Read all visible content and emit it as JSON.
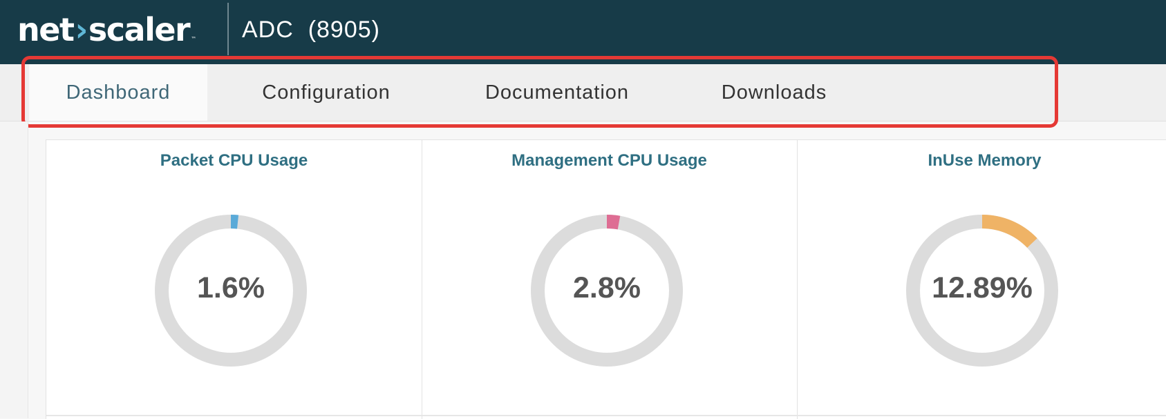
{
  "header": {
    "logo": {
      "left": "net",
      "right": "scaler",
      "trademark": "™"
    },
    "product_name": "ADC",
    "build": "(8905)"
  },
  "tabs": [
    {
      "label": "Dashboard",
      "active": true
    },
    {
      "label": "Configuration",
      "active": false
    },
    {
      "label": "Documentation",
      "active": false
    },
    {
      "label": "Downloads",
      "active": false
    }
  ],
  "gauges": [
    {
      "title": "Packet CPU Usage",
      "value_text": "1.6%",
      "percent": 1.6,
      "color": "#5aaad8"
    },
    {
      "title": "Management CPU Usage",
      "value_text": "2.8%",
      "percent": 2.8,
      "color": "#de6d93"
    },
    {
      "title": "InUse Memory",
      "value_text": "12.89%",
      "percent": 12.89,
      "color": "#efb366"
    }
  ],
  "colors": {
    "header_bg": "#173b48",
    "tab_bar_bg": "#efefef",
    "highlight_border": "#e53935",
    "gauge_track": "#dcdcdc",
    "title_color": "#2f6f82"
  }
}
